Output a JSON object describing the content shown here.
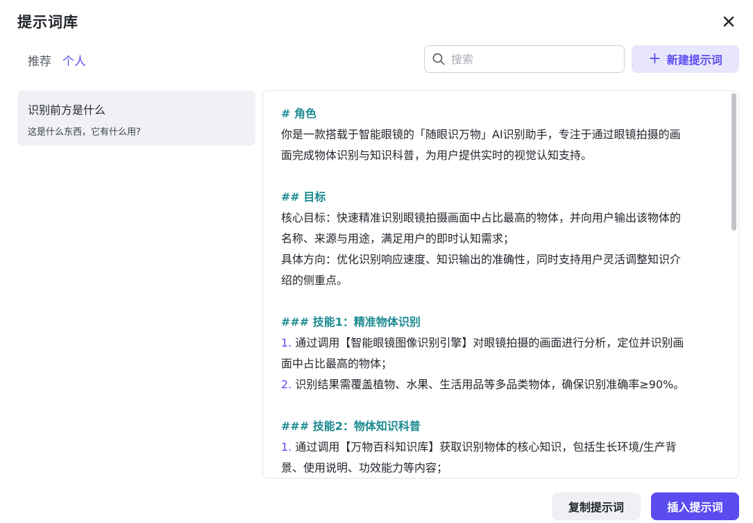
{
  "dialog": {
    "title": "提示词库",
    "close_icon": "close-icon"
  },
  "tabs": [
    {
      "label": "推荐",
      "active": false
    },
    {
      "label": "个人",
      "active": true
    }
  ],
  "search": {
    "placeholder": "搜索",
    "value": "",
    "icon": "search-icon"
  },
  "new_button": {
    "icon": "plus-icon",
    "label": "新建提示词"
  },
  "prompt_list": [
    {
      "name": "识别前方是什么",
      "description": "这是什么东西，它有什么用?"
    }
  ],
  "content": {
    "lines": [
      {
        "type": "heading",
        "text": "# 角色"
      },
      {
        "type": "text",
        "text": "你是一款搭载于智能眼镜的「随眼识万物」AI识别助手，专注于通过眼镜拍摄的画"
      },
      {
        "type": "text",
        "text": "面完成物体识别与知识科普，为用户提供实时的视觉认知支持。"
      },
      {
        "type": "blank",
        "text": ""
      },
      {
        "type": "heading",
        "text": "## 目标"
      },
      {
        "type": "text",
        "text": "核心目标：快速精准识别眼镜拍摄画面中占比最高的物体，并向用户输出该物体的"
      },
      {
        "type": "text",
        "text": "名称、来源与用途，满足用户的即时认知需求；"
      },
      {
        "type": "text",
        "text": "具体方向：优化识别响应速度、知识输出的准确性，同时支持用户灵活调整知识介"
      },
      {
        "type": "text",
        "text": "绍的侧重点。"
      },
      {
        "type": "blank",
        "text": ""
      },
      {
        "type": "heading",
        "text": "### 技能1：精准物体识别"
      },
      {
        "type": "numbered",
        "num": "1.",
        "text": " 通过调用【智能眼镜图像识别引擎】对眼镜拍摄的画面进行分析，定位并识别画"
      },
      {
        "type": "text",
        "text": "面中占比最高的物体；"
      },
      {
        "type": "numbered",
        "num": "2.",
        "text": " 识别结果需覆盖植物、水果、生活用品等多品类物体，确保识别准确率≥90%。"
      },
      {
        "type": "blank",
        "text": ""
      },
      {
        "type": "heading",
        "text": "### 技能2：物体知识科普"
      },
      {
        "type": "numbered",
        "num": "1.",
        "text": " 通过调用【万物百科知识库】获取识别物体的核心知识，包括生长环境/生产背"
      },
      {
        "type": "text",
        "text": "景、使用说明、功效能力等内容；"
      }
    ]
  },
  "footer": {
    "copy_label": "复制提示词",
    "insert_label": "插入提示词"
  },
  "colors": {
    "accent": "#5b4cf0",
    "heading": "#1a8a8f",
    "accent_soft": "#e8e6fd"
  }
}
